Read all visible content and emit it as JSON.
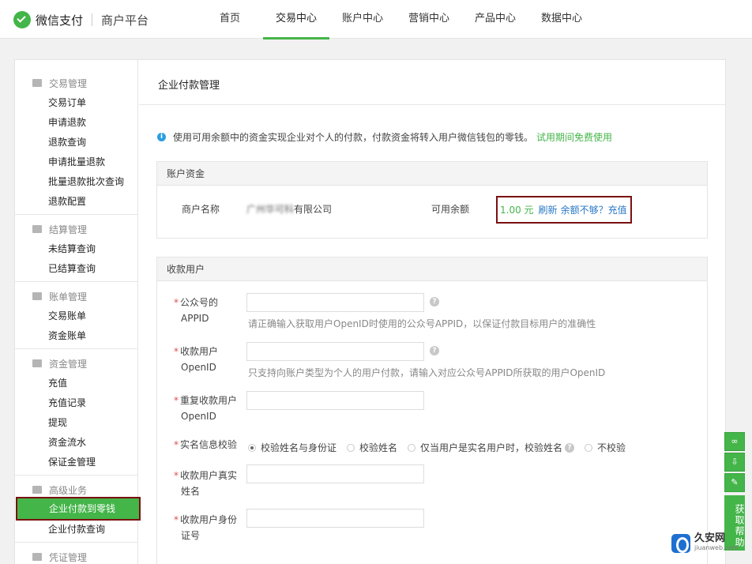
{
  "header": {
    "brand": "微信支付",
    "platform": "商户平台",
    "nav": [
      "首页",
      "交易中心",
      "账户中心",
      "营销中心",
      "产品中心",
      "数据中心"
    ],
    "active_nav": "交易中心"
  },
  "sidebar": {
    "groups": [
      {
        "title": "交易管理",
        "icon": "list-icon",
        "items": [
          "交易订单",
          "申请退款",
          "退款查询",
          "申请批量退款",
          "批量退款批次查询",
          "退款配置"
        ]
      },
      {
        "title": "结算管理",
        "icon": "grid-icon",
        "items": [
          "未结算查询",
          "已结算查询"
        ]
      },
      {
        "title": "账单管理",
        "icon": "document-icon",
        "items": [
          "交易账单",
          "资金账单"
        ]
      },
      {
        "title": "资金管理",
        "icon": "money-bag-icon",
        "items": [
          "充值",
          "充值记录",
          "提现",
          "资金流水",
          "保证金管理"
        ]
      },
      {
        "title": "高级业务",
        "icon": "layers-icon",
        "items": [
          "企业付款到零钱",
          "企业付款查询"
        ]
      },
      {
        "title": "凭证管理",
        "icon": "voucher-icon",
        "items": []
      }
    ],
    "active_item": "企业付款到零钱"
  },
  "main": {
    "title": "企业付款管理",
    "notice": "使用可用余额中的资金实现企业对个人的付款，付款资金将转入用户微信钱包的零钱。",
    "notice_link": "试用期间免费使用",
    "account": {
      "section_title": "账户资金",
      "merchant_label": "商户名称",
      "merchant_name_prefix": "广州华可科",
      "merchant_name_suffix": "有限公司",
      "balance_label": "可用余额",
      "balance": "1.00 元",
      "refresh": "刷新",
      "recharge": "余额不够？充值"
    },
    "payee": {
      "section_title": "收款用户",
      "appid_label_1": "公众号的",
      "appid_label_2": "APPID",
      "appid_hint": "请正确输入获取用户OpenID时使用的公众号APPID，以保证付款目标用户的准确性",
      "openid_label_1": "收款用户",
      "openid_label_2": "OpenID",
      "openid_hint": "只支持向账户类型为个人的用户付款，请输入对应公众号APPID所获取的用户OpenID",
      "repeat_label_1": "重复收款用户",
      "repeat_label_2": "OpenID",
      "verify_label": "实名信息校验",
      "verify_options": [
        "校验姓名与身份证",
        "校验姓名",
        "仅当用户是实名用户时，校验姓名",
        "不校验"
      ],
      "verify_selected": "校验姓名与身份证",
      "realname_label_1": "收款用户真实",
      "realname_label_2": "姓名",
      "idcard_label_1": "收款用户身份",
      "idcard_label_2": "证号"
    }
  },
  "float_help": {
    "label": "获取帮助"
  },
  "watermark": {
    "main": "久安网",
    "sub": "jiuanweb.com"
  }
}
